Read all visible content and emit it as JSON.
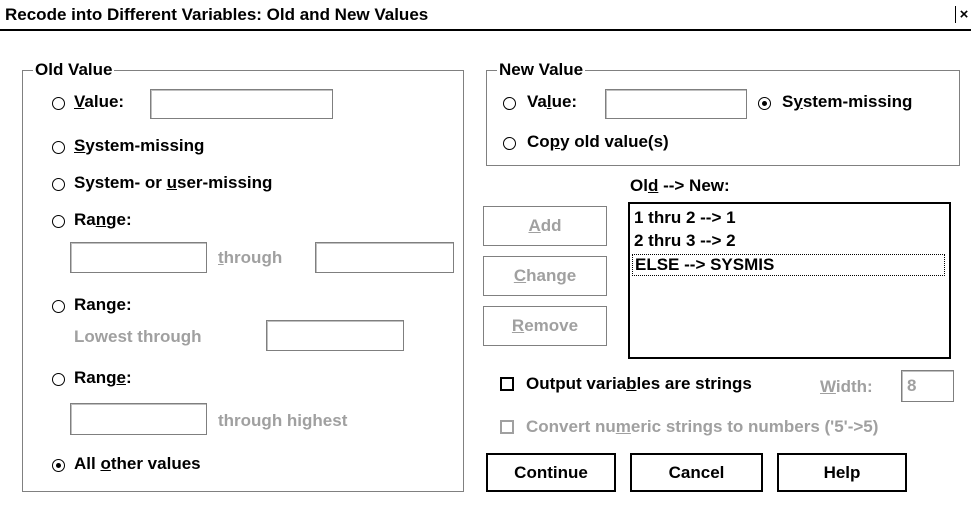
{
  "window": {
    "title": "Recode into Different Variables: Old and New Values",
    "close_glyph": "×"
  },
  "old_value": {
    "group_label": "Old Value",
    "value_label": "Value:",
    "value_input": "",
    "system_missing_label": "System-missing",
    "sys_user_missing_label": "System- or user-missing",
    "range1_label": "Range:",
    "range1_from": "",
    "range1_through": "through",
    "range1_to": "",
    "range2_label": "Range:",
    "range2_lowest_through": "Lowest through",
    "range2_input": "",
    "range3_label": "Range:",
    "range3_input": "",
    "range3_through_highest": "through highest",
    "all_other_label": "All other values",
    "selected": "all_other_values"
  },
  "new_value": {
    "group_label": "New Value",
    "value_label": "Value:",
    "value_input": "",
    "system_missing_label": "System-missing",
    "copy_label": "Copy old value(s)",
    "selected": "system_missing"
  },
  "mapping": {
    "header": "Old --> New:",
    "items": [
      "1 thru 2 --> 1",
      "2 thru 3 --> 2",
      "ELSE --> SYSMIS"
    ],
    "selected_index": 2
  },
  "buttons": {
    "add": "Add",
    "change": "Change",
    "remove": "Remove",
    "continue": "Continue",
    "cancel": "Cancel",
    "help": "Help"
  },
  "options": {
    "output_strings_label": "Output variables are strings",
    "output_strings_checked": false,
    "width_label": "Width:",
    "width_value": "8",
    "convert_label": "Convert numeric strings to numbers ('5'->5)",
    "convert_checked": false
  }
}
